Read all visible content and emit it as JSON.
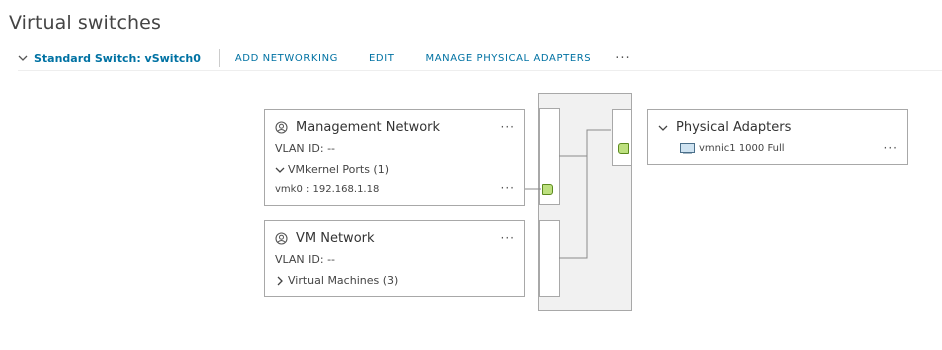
{
  "page": {
    "title": "Virtual switches"
  },
  "toolbar": {
    "switch_label": "Standard Switch: vSwitch0",
    "add_networking": "ADD NETWORKING",
    "edit": "EDIT",
    "manage_adapters": "MANAGE PHYSICAL ADAPTERS",
    "more": "···"
  },
  "management_network": {
    "name": "Management Network",
    "vlan": "VLAN ID: --",
    "vmkernel_ports": "VMkernel Ports (1)",
    "vmk": "vmk0 : 192.168.1.18",
    "more": "···",
    "vmk_more": "···"
  },
  "vm_network": {
    "name": "VM Network",
    "vlan": "VLAN ID: --",
    "virtual_machines": "Virtual Machines (3)",
    "more": "···"
  },
  "physical_adapters": {
    "title": "Physical Adapters",
    "adapter": "vmnic1 1000 Full",
    "more": "···"
  },
  "colors": {
    "link": "#0072a3",
    "port_green": "#bde07f",
    "switch_bg": "#f1f1f1",
    "border": "#a8a8a8"
  },
  "icons": {
    "network": "globe-network-icon",
    "nic": "nic-icon",
    "expand": "chevron-down-icon",
    "collapse": "chevron-right-icon"
  }
}
